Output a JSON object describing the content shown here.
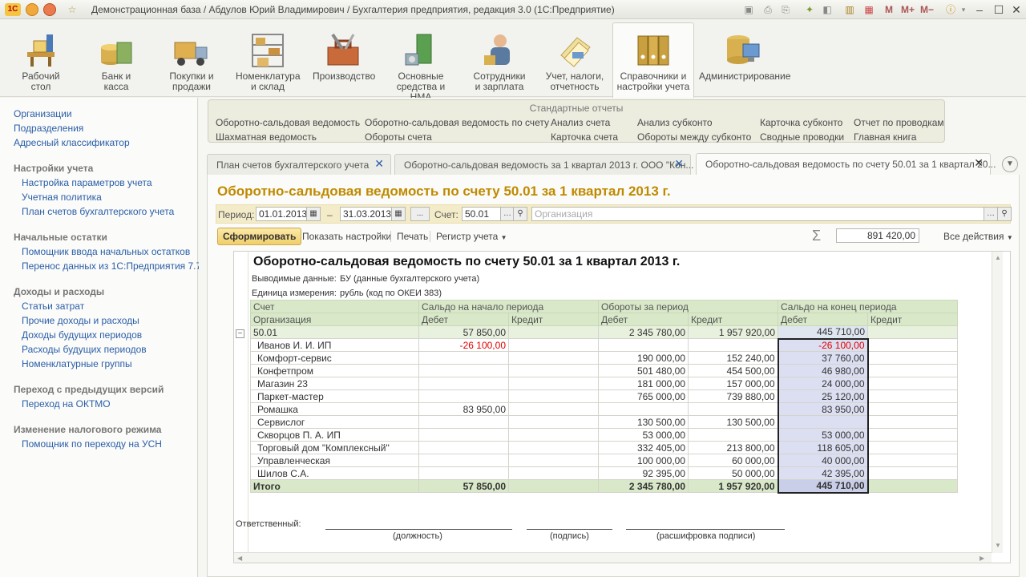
{
  "window": {
    "title": "Демонстрационная база / Абдулов Юрий Владимирович / Бухгалтерия предприятия, редакция 3.0  (1С:Предприятие)",
    "logo_text": "1С",
    "memory_buttons": [
      "M",
      "M+",
      "M−"
    ]
  },
  "sections": [
    {
      "label": "Рабочий\nстол",
      "icon": "desk-icon"
    },
    {
      "label": "Банк и\nкасса",
      "icon": "bank-icon"
    },
    {
      "label": "Покупки и\nпродажи",
      "icon": "truck-icon"
    },
    {
      "label": "Номенклатура\nи склад",
      "icon": "warehouse-icon"
    },
    {
      "label": "Производство",
      "icon": "toolbox-icon"
    },
    {
      "label": "Основные\nсредства и НМА",
      "icon": "assets-icon"
    },
    {
      "label": "Сотрудники\nи зарплата",
      "icon": "employee-icon"
    },
    {
      "label": "Учет, налоги,\nотчетность",
      "icon": "reports-icon"
    },
    {
      "label": "Справочники и\nнастройки учета",
      "icon": "binders-icon",
      "active": true
    },
    {
      "label": "Администрирование",
      "icon": "admin-icon"
    }
  ],
  "left_panel": {
    "top_links": [
      "Организации",
      "Подразделения",
      "Адресный классификатор"
    ],
    "groups": [
      {
        "title": "Настройки учета",
        "items": [
          "Настройка параметров учета",
          "Учетная политика",
          "План счетов бухгалтерского учета"
        ]
      },
      {
        "title": "Начальные остатки",
        "items": [
          "Помощник ввода начальных остатков",
          "Перенос данных из 1С:Предприятия 7.7"
        ]
      },
      {
        "title": "Доходы и расходы",
        "items": [
          "Статьи затрат",
          "Прочие доходы и расходы",
          "Доходы будущих периодов",
          "Расходы будущих периодов",
          "Номенклатурные группы"
        ]
      },
      {
        "title": "Переход с предыдущих версий",
        "items": [
          "Переход на ОКТМО"
        ]
      },
      {
        "title": "Изменение налогового режима",
        "items": [
          "Помощник по переходу на УСН"
        ]
      }
    ]
  },
  "standard_reports": {
    "title": "Стандартные отчеты",
    "links": [
      "Оборотно-сальдовая ведомость",
      "Шахматная ведомость",
      "Оборотно-сальдовая ведомость по счету",
      "Обороты счета",
      "Анализ счета",
      "Карточка счета",
      "Анализ субконто",
      "Обороты между субконто",
      "Карточка субконто",
      "Сводные проводки",
      "Отчет по проводкам",
      "Главная книга"
    ]
  },
  "tabs": [
    {
      "label": "План счетов бухгалтерского учета"
    },
    {
      "label": "Оборотно-сальдовая ведомость за 1 квартал 2013 г. ООО \"Кон..."
    },
    {
      "label": "Оборотно-сальдовая ведомость по счету 50.01 за 1 квартал 20...",
      "active": true
    }
  ],
  "form": {
    "title": "Оборотно-сальдовая ведомость по счету 50.01 за 1 квартал 2013 г.",
    "period_label": "Период:",
    "date_from": "01.01.2013",
    "dash": "–",
    "date_to": "31.03.2013",
    "ellipsis": "...",
    "account_label": "Счет:",
    "account": "50.01",
    "org_placeholder": "Организация",
    "generate_button": "Сформировать",
    "show_settings": "Показать настройки",
    "print": "Печать",
    "account_register": "Регистр учета",
    "sum_value": "891 420,00",
    "all_actions": "Все действия"
  },
  "report": {
    "title": "Оборотно-сальдовая ведомость по счету 50.01 за 1 квартал 2013 г.",
    "meta": [
      {
        "label": "Выводимые данные:",
        "value": "БУ (данные бухгалтерского учета)"
      },
      {
        "label": "Единица измерения:",
        "value": "рубль (код по ОКЕИ 383)"
      }
    ],
    "header1": [
      "Счет",
      "Сальдо на начало периода",
      "Обороты за период",
      "Сальдо на конец периода"
    ],
    "header2": [
      "Организация",
      "Дебет",
      "Кредит",
      "Дебет",
      "Кредит",
      "Дебет",
      "Кредит"
    ],
    "account_row": [
      "50.01",
      "57 850,00",
      "",
      "2 345 780,00",
      "1 957 920,00",
      "445 710,00",
      ""
    ],
    "rows": [
      [
        "Иванов И. И. ИП",
        "-26 100,00",
        "",
        "",
        "",
        "-26 100,00",
        ""
      ],
      [
        "Комфорт-сервис",
        "",
        "",
        "190 000,00",
        "152 240,00",
        "37 760,00",
        ""
      ],
      [
        "Конфетпром",
        "",
        "",
        "501 480,00",
        "454 500,00",
        "46 980,00",
        ""
      ],
      [
        "Магазин 23",
        "",
        "",
        "181 000,00",
        "157 000,00",
        "24 000,00",
        ""
      ],
      [
        "Паркет-мастер",
        "",
        "",
        "765 000,00",
        "739 880,00",
        "25 120,00",
        ""
      ],
      [
        "Ромашка",
        "83 950,00",
        "",
        "",
        "",
        "83 950,00",
        ""
      ],
      [
        "Сервислог",
        "",
        "",
        "130 500,00",
        "130 500,00",
        "",
        ""
      ],
      [
        "Скворцов П. А. ИП",
        "",
        "",
        "53 000,00",
        "",
        "53 000,00",
        ""
      ],
      [
        "Торговый дом \"Комплексный\"",
        "",
        "",
        "332 405,00",
        "213 800,00",
        "118 605,00",
        ""
      ],
      [
        "Управленческая",
        "",
        "",
        "100 000,00",
        "60 000,00",
        "40 000,00",
        ""
      ],
      [
        "Шилов С.А.",
        "",
        "",
        "92 395,00",
        "50 000,00",
        "42 395,00",
        ""
      ]
    ],
    "total_row": [
      "Итого",
      "57 850,00",
      "",
      "2 345 780,00",
      "1 957 920,00",
      "445 710,00",
      ""
    ],
    "responsible_label": "Ответственный:",
    "sign_captions": [
      "(должность)",
      "(подпись)",
      "(расшифровка подписи)"
    ]
  },
  "colors": {
    "accent_title": "#c08a00",
    "link": "#2a5ea8",
    "negative": "#e00000",
    "table_header": "#d9e8c9",
    "selection": "#dcdff2"
  }
}
